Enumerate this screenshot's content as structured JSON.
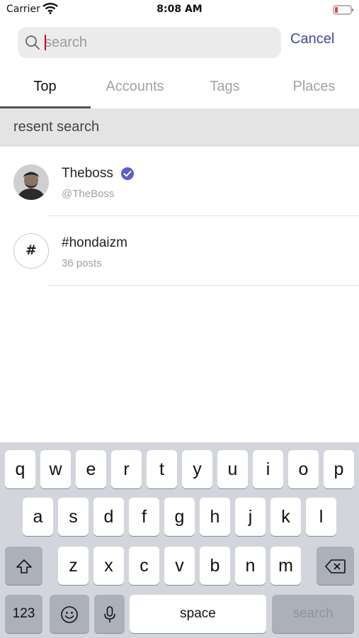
{
  "status_bar": {
    "carrier": "Carrier",
    "time": "8:08 AM",
    "wifi_icon": "wifi-icon",
    "battery_icon": "battery-low-icon",
    "battery_color": "#e0463c"
  },
  "search": {
    "placeholder": "search",
    "value": "",
    "cancel_label": "Cancel",
    "accent_color": "#3f4a9a"
  },
  "tabs": [
    {
      "label": "Top",
      "active": true
    },
    {
      "label": "Accounts",
      "active": false
    },
    {
      "label": "Tags",
      "active": false
    },
    {
      "label": "Places",
      "active": false
    }
  ],
  "recent": {
    "header": "resent search",
    "items": [
      {
        "type": "account",
        "title": "Theboss",
        "subtitle": "@TheBoss",
        "verified": true,
        "icon": "avatar"
      },
      {
        "type": "tag",
        "title": "#hondaizm",
        "subtitle": "36 posts",
        "icon_glyph": "#"
      }
    ]
  },
  "keyboard": {
    "row1": [
      "q",
      "w",
      "e",
      "r",
      "t",
      "y",
      "u",
      "i",
      "o",
      "p"
    ],
    "row2": [
      "a",
      "s",
      "d",
      "f",
      "g",
      "h",
      "j",
      "k",
      "l"
    ],
    "row3": [
      "z",
      "x",
      "c",
      "v",
      "b",
      "n",
      "m"
    ],
    "numbers_label": "123",
    "space_label": "space",
    "search_label": "search",
    "icons": [
      "shift-icon",
      "backspace-icon",
      "emoji-icon",
      "microphone-icon"
    ]
  },
  "colors": {
    "verified_badge": "#5b5fc7",
    "cursor": "#d0021b"
  }
}
